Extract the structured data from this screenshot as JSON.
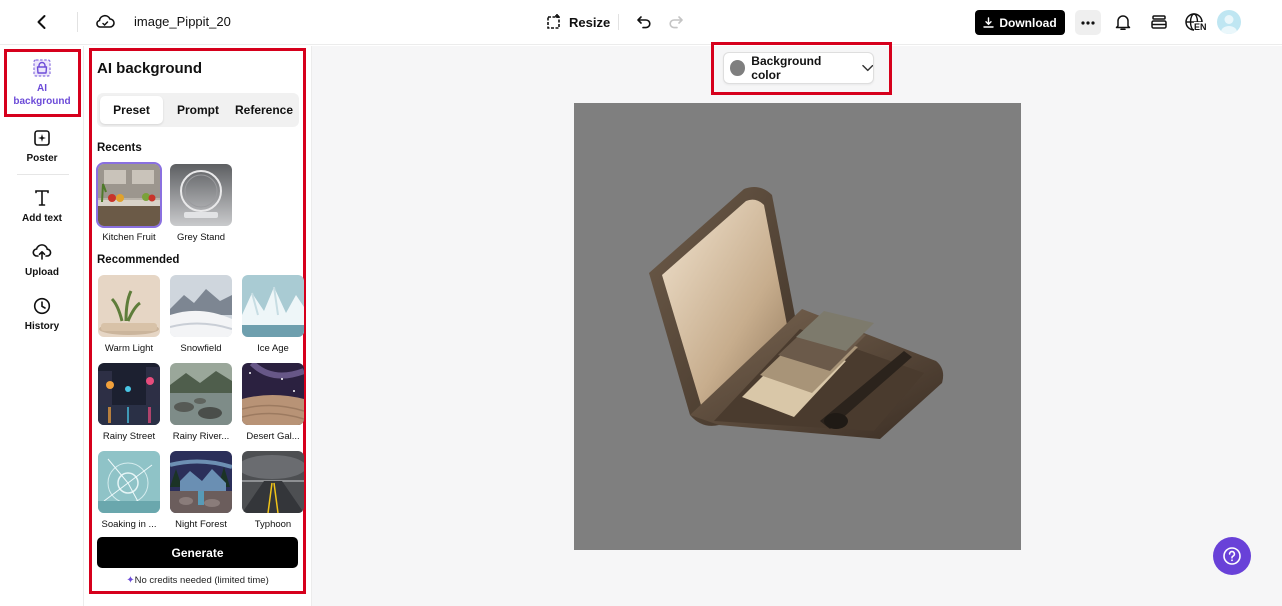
{
  "topbar": {
    "filename": "image_Pippit_20",
    "resize_label": "Resize",
    "download_label": "Download",
    "lang_label": "EN",
    "icons": [
      "back-icon",
      "cloud-sync-icon",
      "resize-icon",
      "undo-icon",
      "redo-icon",
      "download-icon",
      "more-icon",
      "bell-icon",
      "layers-icon",
      "globe-icon"
    ]
  },
  "leftnav": {
    "items": [
      {
        "label": "AI background",
        "icon": "ai-background-icon",
        "active": true
      },
      {
        "label": "Poster",
        "icon": "poster-icon"
      },
      {
        "label": "Add text",
        "icon": "text-icon"
      },
      {
        "label": "Upload",
        "icon": "upload-icon"
      },
      {
        "label": "History",
        "icon": "history-icon"
      }
    ]
  },
  "panel": {
    "title": "AI background",
    "tabs": [
      "Preset",
      "Prompt",
      "Reference"
    ],
    "active_tab": "Preset",
    "recents_heading": "Recents",
    "recents": [
      {
        "label": "Kitchen Fruit",
        "selected": true
      },
      {
        "label": "Grey Stand"
      }
    ],
    "recommended_heading": "Recommended",
    "recommended": [
      {
        "label": "Warm Light"
      },
      {
        "label": "Snowfield"
      },
      {
        "label": "Ice Age"
      },
      {
        "label": "Rainy Street"
      },
      {
        "label": "Rainy River..."
      },
      {
        "label": "Desert Gal..."
      },
      {
        "label": "Soaking in ..."
      },
      {
        "label": "Night Forest"
      },
      {
        "label": "Typhoon"
      }
    ],
    "generate_label": "Generate",
    "note": "No credits needed (limited time)"
  },
  "canvas": {
    "bg_color_label": "Background color",
    "bg_color": "#7f7f7f",
    "accent": "#6941d8",
    "highlight": "#d6001c"
  }
}
